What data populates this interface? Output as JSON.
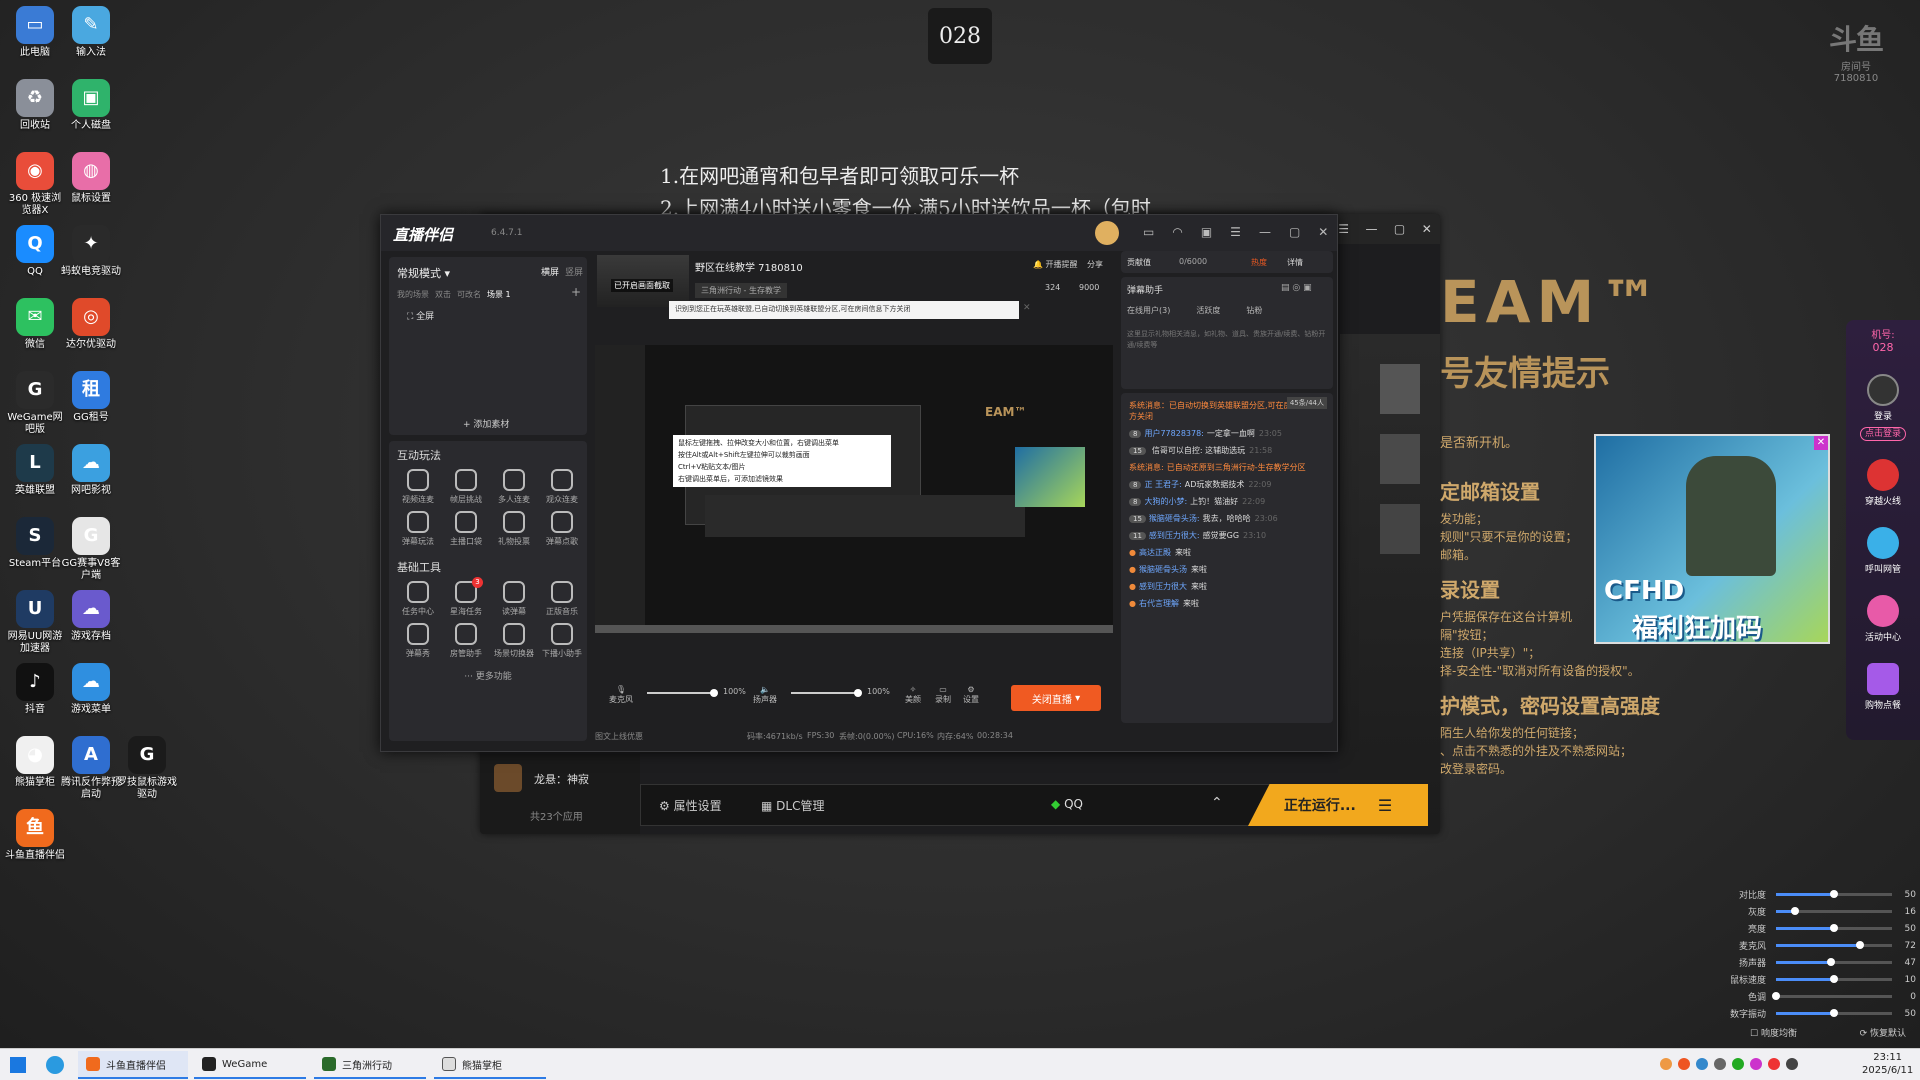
{
  "counter": "028",
  "watermark": {
    "brand": "斗鱼",
    "sub": "房间号",
    "room": "7180810"
  },
  "notice": {
    "line1": "1.在网吧通宵和包早者即可领取可乐一杯",
    "line2": "2.上网满4小时送小零食一份,满5小时送饮品一杯（包时"
  },
  "desktop_icons": [
    {
      "label": "此电脑",
      "color": "#3a7bd5",
      "glyph": "▭"
    },
    {
      "label": "输入法",
      "color": "#4aa8e0",
      "glyph": "✎"
    },
    {
      "label": "回收站",
      "color": "#8a8f99",
      "glyph": "♻"
    },
    {
      "label": "个人磁盘",
      "color": "#2fb36b",
      "glyph": "▣"
    },
    {
      "label": "360 极速浏览器X",
      "color": "#e94d3a",
      "glyph": "◉"
    },
    {
      "label": "鼠标设置",
      "color": "#e86ea8",
      "glyph": "◍"
    },
    {
      "label": "QQ",
      "color": "#1a8cff",
      "glyph": "Q"
    },
    {
      "label": "蚂蚁电竞驱动",
      "color": "#2a2a2a",
      "glyph": "✦"
    },
    {
      "label": "微信",
      "color": "#2dc160",
      "glyph": "✉"
    },
    {
      "label": "达尔优驱动",
      "color": "#e04a2a",
      "glyph": "◎"
    },
    {
      "label": "WeGame网吧版",
      "color": "#2b2b2b",
      "glyph": "G"
    },
    {
      "label": "GG租号",
      "color": "#2f7be0",
      "glyph": "租"
    },
    {
      "label": "英雄联盟",
      "color": "#1e3a4a",
      "glyph": "L"
    },
    {
      "label": "网吧影视",
      "color": "#3ba0e0",
      "glyph": "☁"
    },
    {
      "label": "Steam平台",
      "color": "#1b2838",
      "glyph": "S"
    },
    {
      "label": "GG赛事V8客户端",
      "color": "#e6e6e6",
      "glyph": "G"
    },
    {
      "label": "网易UU网游加速器",
      "color": "#1f3b63",
      "glyph": "U"
    },
    {
      "label": "游戏存档",
      "color": "#6a5acd",
      "glyph": "☁"
    },
    {
      "label": "抖音",
      "color": "#111",
      "glyph": "♪"
    },
    {
      "label": "游戏菜单",
      "color": "#2f8fe0",
      "glyph": "☁"
    },
    {
      "label": "熊猫掌柜",
      "color": "#f0f0f0",
      "glyph": "◕"
    },
    {
      "label": "腾讯反作弊预启动",
      "color": "#2f6ed0",
      "glyph": "A"
    },
    {
      "label": "罗技鼠标游戏驱动",
      "color": "#1b1b1b",
      "glyph": "G"
    },
    {
      "label": "斗鱼直播伴侣",
      "color": "#f06a1d",
      "glyph": "鱼"
    }
  ],
  "bg_window": {
    "title_big": "EAM™",
    "subtitle": "号友情提示",
    "side_lines": [
      {
        "text": "是否新开机。",
        "size": 13
      },
      {
        "text": "定邮箱设置",
        "size": 20
      },
      {
        "text": "发功能；",
        "size": 12
      },
      {
        "text": "规则\"只要不是你的设置；",
        "size": 12
      },
      {
        "text": "邮箱。",
        "size": 12
      },
      {
        "text": "录设置",
        "size": 20
      },
      {
        "text": "户凭据保存在这台计算机",
        "size": 12
      },
      {
        "text": "隔\"按钮；",
        "size": 12
      },
      {
        "text": "连接（IP共享）\"；",
        "size": 12
      },
      {
        "text": "择-安全性-\"取消对所有设备的授权\"。",
        "size": 12
      },
      {
        "text": "护模式，密码设置高强度",
        "size": 20
      },
      {
        "text": "陌生人给你发的任何链接；",
        "size": 12
      },
      {
        "text": "、点击不熟悉的外挂及不熟悉网站；",
        "size": 12
      },
      {
        "text": "改登录密码。",
        "size": 12
      }
    ],
    "user": "龙悬：神寂",
    "apps_count": "共23个应用",
    "attr_settings": "属性设置",
    "dlc": "DLC管理",
    "qq": "QQ",
    "running": "正在运行..."
  },
  "app": {
    "logo": "直播伴侣",
    "version": "6.4.7.1",
    "mode": "常规模式",
    "orient_h": "横屏",
    "orient_v": "竖屏",
    "scene_tabs": [
      "我的场景",
      "双击",
      "可改名",
      "场景 1"
    ],
    "source": "全屏",
    "add_material": "添加素材",
    "interact_title": "互动玩法",
    "interact_tools": [
      "视频连麦",
      "帧层挑战",
      "多人连麦",
      "观众连麦",
      "弹幕玩法",
      "主播口袋",
      "礼物投票",
      "弹幕点歌"
    ],
    "basic_title": "基础工具",
    "basic_tools": [
      "任务中心",
      "星海任务",
      "读弹幕",
      "正版音乐",
      "弹幕秀",
      "房管助手",
      "场景切换器",
      "下播小助手"
    ],
    "badge": "3",
    "more": "更多功能",
    "room_title": "野区在线教学 7180810",
    "screenshot_hint": "已开启画面截取",
    "category": "三角洲行动 - 生存教学",
    "hot": "324",
    "likes": "9000",
    "start_remind": "开播提醒",
    "share": "分享",
    "toast": "识别到您正在玩英雄联盟,已自动切换到英雄联盟分区,可在房间信息下方关闭",
    "tooltip_lines": [
      "鼠标左键拖拽、拉伸改变大小和位置，右键调出菜单",
      "按住Alt或Alt+Shift左键拉伸可以裁剪画面",
      "Ctrl+V粘贴文本/图片",
      "右键调出菜单后，可添加滤镜效果"
    ],
    "mic_label": "麦克风",
    "mic_pct": "100%",
    "spk_label": "扬声器",
    "spk_pct": "100%",
    "beauty": "美颜",
    "record": "录制",
    "settings": "设置",
    "stop_btn": "关闭直播",
    "stat_upload": "图文上线优惠",
    "stat_bitrate": "码率:4671kb/s",
    "stat_fps": "FPS:30",
    "stat_drop": "丢帧:0(0.00%)",
    "stat_cpu": "CPU:16%",
    "stat_mem": "内存:64%",
    "stat_time": "00:28:34",
    "contrib": "贡献值",
    "contrib_val": "0/6000",
    "hot_rank": "热度",
    "detail": "详情",
    "danmu_helper": "弹幕助手",
    "right_tabs": [
      "在线用户(3)",
      "活跃度",
      "钻粉"
    ],
    "right_hint": "这里显示礼物相关消息，如礼物、道具、贵族开通/续费、钻粉开通/续费等",
    "sys_top": "系统消息：已自动切换到英雄联盟分区,可在房间信息下方关闭",
    "count_badge": "45条/44人",
    "chat": [
      {
        "lvl": "8",
        "user": "用户77828378:",
        "msg": "一定拿一血啊",
        "time": "23:05"
      },
      {
        "lvl": "15",
        "user": "",
        "msg": "信哥可以自控: 这辅助选玩",
        "time": "21:58",
        "sys": false
      },
      {
        "lvl": "",
        "user": "系统消息:",
        "msg": "已自动还原到三角洲行动-生存教学分区",
        "sys": true
      },
      {
        "lvl": "8",
        "user": "正 王君子:",
        "msg": "AD玩家数据技术",
        "time": "22:09"
      },
      {
        "lvl": "8",
        "user": "大狗的小梦:",
        "msg": "上钓！猫油好",
        "time": "22:09"
      },
      {
        "lvl": "15",
        "user": "猴脑砸骨头汤:",
        "msg": "我去，哈哈哈",
        "time": "23:06"
      },
      {
        "lvl": "11",
        "user": "感到压力很大:",
        "msg": "感觉要GG",
        "time": "23:10"
      }
    ],
    "entries": [
      {
        "user": "高达正殿",
        "msg": "来啦"
      },
      {
        "user": "猴脑砸骨头汤",
        "msg": "来啦"
      },
      {
        "user": "感到压力很大",
        "msg": "来啦"
      },
      {
        "user": "右代言理解",
        "msg": "来啦"
      }
    ]
  },
  "sidebar": {
    "machine_label": "机号:",
    "machine": "028",
    "items": [
      "登录",
      "点击登录",
      "穿越火线",
      "呼叫网管",
      "活动中心",
      "购物点餐"
    ]
  },
  "ad": {
    "brand": "CFHD",
    "slogan": "福利狂加码"
  },
  "sliders": [
    {
      "name": "对比度",
      "value": 50,
      "max": 100
    },
    {
      "name": "灰度",
      "value": 16,
      "max": 100
    },
    {
      "name": "亮度",
      "value": 50,
      "max": 100
    },
    {
      "name": "麦克风",
      "value": 72,
      "max": 100
    },
    {
      "name": "扬声器",
      "value": 47,
      "max": 100
    },
    {
      "name": "鼠标速度",
      "value": 10,
      "max": 20
    },
    {
      "name": "色调",
      "value": 0,
      "max": 100
    },
    {
      "name": "数字振动",
      "value": 50,
      "max": 100
    }
  ],
  "slider_footer": {
    "left": "响度均衡",
    "right": "恢复默认"
  },
  "taskbar": {
    "tasks": [
      "斗鱼直播伴侣",
      "WeGame",
      "三角洲行动",
      "熊猫掌柜"
    ],
    "time": "23:11",
    "date": "2025/6/11"
  }
}
